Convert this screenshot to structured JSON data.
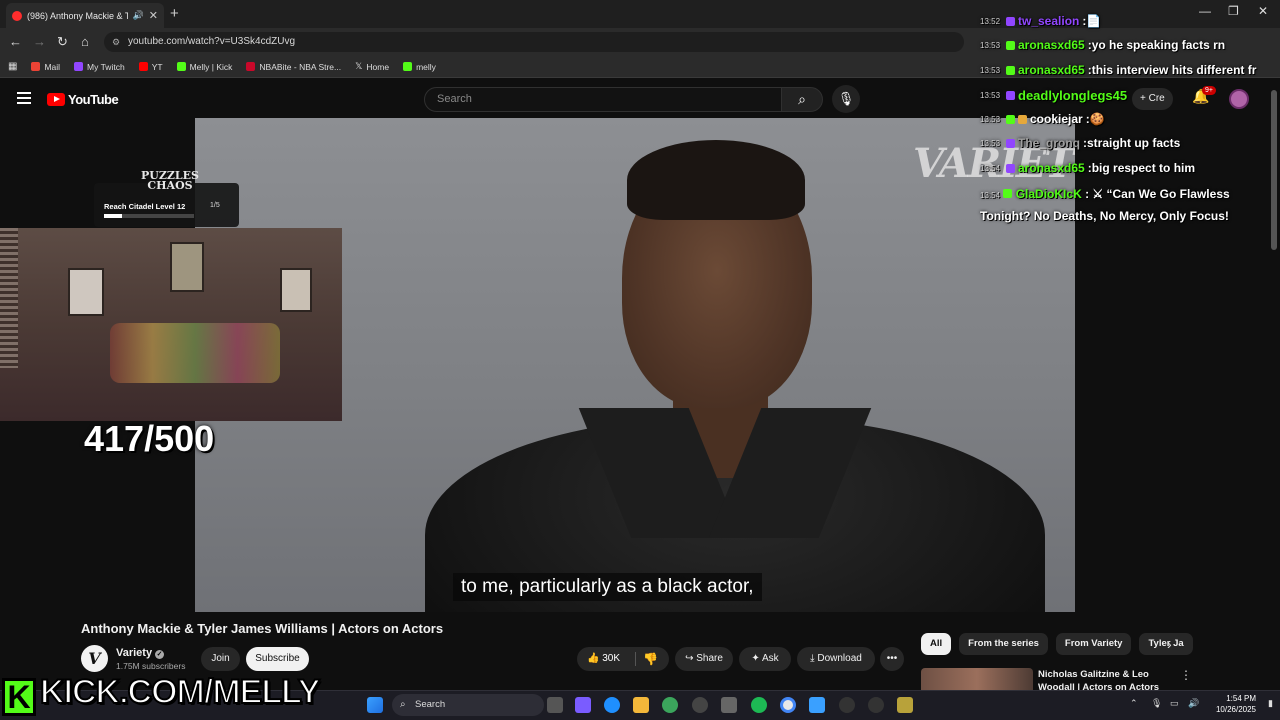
{
  "browser": {
    "tab_title": "(986) Anthony Mackie & Ty",
    "tab_close": "✕",
    "new_tab": "+",
    "url": "youtube.com/watch?v=U3Sk4cdZUvg",
    "bookmarks": [
      {
        "label": "Mail",
        "color": "#ea4335"
      },
      {
        "label": "My Twitch",
        "color": "#9146ff"
      },
      {
        "label": "YT",
        "color": "#ff0000"
      },
      {
        "label": "Melly | Kick",
        "color": "#53fc18"
      },
      {
        "label": "NBABite - NBA Stre...",
        "color": "#c9082a"
      },
      {
        "label": "Home",
        "color": "#ffffff"
      },
      {
        "label": "melly",
        "color": "#53fc18"
      }
    ]
  },
  "youtube": {
    "logo": "YouTube",
    "search_placeholder": "Search",
    "create_label": "Cre",
    "notif_badge": "9+",
    "video_title": "Anthony Mackie & Tyler James Williams | Actors on Actors",
    "channel_name": "Variety",
    "channel_initial": "V",
    "channel_subs": "1.75M subscribers",
    "join_label": "Join",
    "subscribe_label": "Subscribe",
    "likes": "30K",
    "share_label": "Share",
    "ask_label": "Ask",
    "download_label": "Download",
    "more_label": "•••",
    "chips": [
      "All",
      "From the series",
      "From Variety",
      "Tyler Ja"
    ],
    "rec_title": "Nicholas Galitzine & Leo Woodall | Actors on Actors"
  },
  "video": {
    "watermark": "VARIETY",
    "caption": "to me, particularly as a black actor,"
  },
  "overlay": {
    "goal_logo_line1": "PUZZLES",
    "goal_logo_line2": "CHAOS",
    "goal_title": "Reach Citadel Level 12",
    "goal_count": "1/5",
    "goal_progress": 0.2,
    "sub_count": "417/500",
    "kick_letter": "K",
    "kick_text": "KICK.COM/MELLY"
  },
  "chat": {
    "messages": [
      {
        "time": "13:52",
        "user": "tw_sealion",
        "user_color": "#9146ff",
        "text": "📄"
      },
      {
        "time": "13:53",
        "user": "aronasxd65",
        "user_color": "#53fc18",
        "text": "yo he speaking facts rn"
      },
      {
        "time": "13:53",
        "user": "aronasxd65",
        "user_color": "#53fc18",
        "text": "this interview hits different fr"
      },
      {
        "time": "13:53",
        "user": "deadlylonglegs45",
        "user_color": "#53fc18",
        "text": ""
      },
      {
        "time": "13:53",
        "user": "cookiejar",
        "user_color": "#ffffff",
        "text": "🍪"
      },
      {
        "time": "13:53",
        "user": "The_gronq",
        "user_color": "#a0a0a0",
        "text": "straight up facts"
      },
      {
        "time": "13:54",
        "user": "aronasxd65",
        "user_color": "#53fc18",
        "text": "big respect to him"
      }
    ],
    "last_message": {
      "time": "13:54",
      "user": "GlaDioKIcK",
      "user_color": "#53fc18",
      "text": "⚔ “Can We Go Flawless Tonight? No Deaths, No Mercy, Only Focus!"
    }
  },
  "taskbar": {
    "search_label": "Search",
    "time": "1:54 PM",
    "date": "10/26/2025"
  },
  "colors": {
    "accent": "#ff0000",
    "kick_green": "#53fc18",
    "bg": "#0f0f0f"
  }
}
